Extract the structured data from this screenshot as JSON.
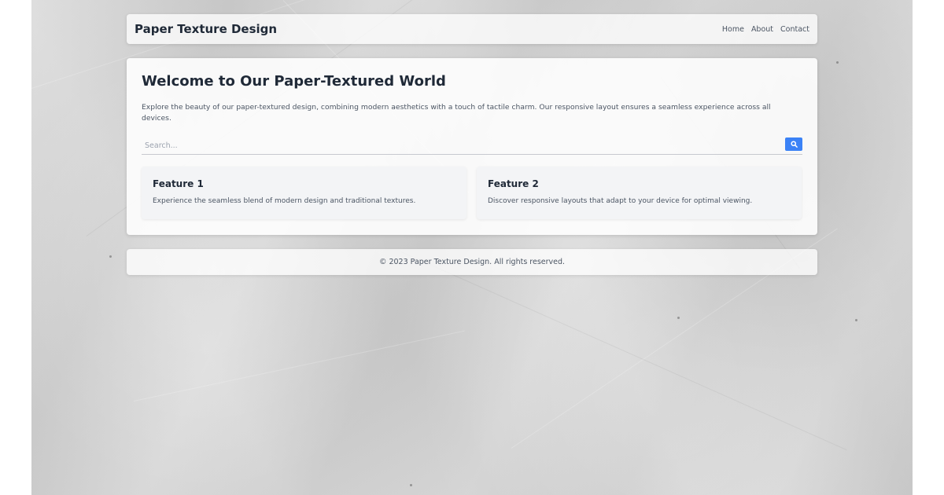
{
  "header": {
    "title": "Paper Texture Design",
    "nav": [
      {
        "label": "Home"
      },
      {
        "label": "About"
      },
      {
        "label": "Contact"
      }
    ]
  },
  "main": {
    "heading": "Welcome to Our Paper-Textured World",
    "intro": "Explore the beauty of our paper-textured design, combining modern aesthetics with a touch of tactile charm. Our responsive layout ensures a seamless experience across all devices.",
    "search": {
      "placeholder": "Search...",
      "button_icon": "search-icon"
    },
    "features": [
      {
        "title": "Feature 1",
        "text": "Experience the seamless blend of modern design and traditional textures."
      },
      {
        "title": "Feature 2",
        "text": "Discover responsive layouts that adapt to your device for optimal viewing."
      }
    ]
  },
  "footer": {
    "text": "© 2023 Paper Texture Design. All rights reserved."
  },
  "colors": {
    "background": "#d8d8d8",
    "card": "#ffffff",
    "text_primary": "#1f2937",
    "text_secondary": "#4b5563",
    "accent": "#3b82f6"
  }
}
